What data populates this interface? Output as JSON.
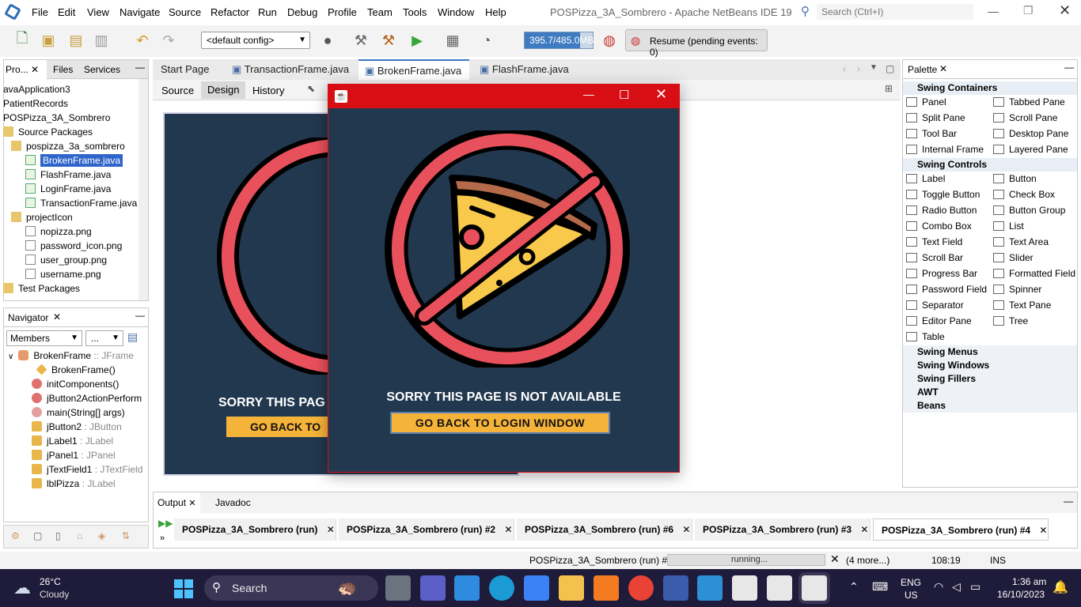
{
  "window": {
    "title": "POSPizza_3A_Sombrero - Apache NetBeans IDE 19"
  },
  "menu": [
    "File",
    "Edit",
    "View",
    "Navigate",
    "Source",
    "Refactor",
    "Run",
    "Debug",
    "Profile",
    "Team",
    "Tools",
    "Window",
    "Help"
  ],
  "search": {
    "placeholder": "Search (Ctrl+I)"
  },
  "toolbar": {
    "config": "<default config>",
    "memory": "395.7/485.0MB",
    "resume": "Resume (pending events: 0)",
    "memory_fraction": 0.816
  },
  "projects": {
    "tabs": [
      "Pro...",
      "Files",
      "Services"
    ],
    "tree": [
      "avaApplication3",
      "PatientRecords",
      "POSPizza_3A_Sombrero",
      "Source Packages",
      "pospizza_3a_sombrero",
      "BrokenFrame.java",
      "FlashFrame.java",
      "LoginFrame.java",
      "TransactionFrame.java",
      "projectIcon",
      "nopizza.png",
      "password_icon.png",
      "user_group.png",
      "username.png",
      "Test Packages"
    ]
  },
  "navigator": {
    "title": "Navigator",
    "filter": "Members",
    "filter2": "...",
    "items": [
      {
        "name": "BrokenFrame",
        "type": " :: JFrame"
      },
      {
        "name": "BrokenFrame()",
        "type": ""
      },
      {
        "name": "initComponents()",
        "type": ""
      },
      {
        "name": "jButton2ActionPerform",
        "type": ""
      },
      {
        "name": "main(String[] args)",
        "type": ""
      },
      {
        "name": "jButton2",
        "type": " : JButton"
      },
      {
        "name": "jLabel1",
        "type": " : JLabel"
      },
      {
        "name": "jPanel1",
        "type": " : JPanel"
      },
      {
        "name": "jTextField1",
        "type": " : JTextField"
      },
      {
        "name": "lblPizza",
        "type": " : JLabel"
      }
    ]
  },
  "editor": {
    "tabs": [
      "Start Page",
      "TransactionFrame.java",
      "BrokenFrame.java",
      "FlashFrame.java"
    ],
    "subtabs": [
      "Source",
      "Design",
      "History"
    ],
    "design_text": "SORRY THIS PAG",
    "design_button": "GO BACK TO"
  },
  "dialog": {
    "message": "SORRY THIS PAGE IS NOT AVAILABLE",
    "button": "GO BACK TO LOGIN WINDOW"
  },
  "palette": {
    "title": "Palette",
    "containers_title": "Swing Containers",
    "containers": [
      "Panel",
      "Tabbed Pane",
      "Split Pane",
      "Scroll Pane",
      "Tool Bar",
      "Desktop Pane",
      "Internal Frame",
      "Layered Pane"
    ],
    "controls_title": "Swing Controls",
    "controls": [
      "Label",
      "Button",
      "Toggle Button",
      "Check Box",
      "Radio Button",
      "Button Group",
      "Combo Box",
      "List",
      "Text Field",
      "Text Area",
      "Scroll Bar",
      "Slider",
      "Progress Bar",
      "Formatted Field",
      "Password Field",
      "Spinner",
      "Separator",
      "Text Pane",
      "Editor Pane",
      "Tree",
      "Table"
    ],
    "collapsed": [
      "Swing Menus",
      "Swing Windows",
      "Swing Fillers",
      "AWT",
      "Beans"
    ]
  },
  "output": {
    "tabs": [
      "Output",
      "Javadoc"
    ],
    "runs": [
      "POSPizza_3A_Sombrero (run)",
      "POSPizza_3A_Sombrero (run) #2",
      "POSPizza_3A_Sombrero (run) #6",
      "POSPizza_3A_Sombrero (run) #3",
      "POSPizza_3A_Sombrero (run) #4"
    ]
  },
  "status": {
    "task": "POSPizza_3A_Sombrero (run) #4",
    "progress": "running...",
    "more": "(4 more...)",
    "position": "108:19",
    "mode": "INS"
  },
  "taskbar": {
    "temp": "26°C",
    "weather": "Cloudy",
    "search": "Search",
    "lang1": "ENG",
    "lang2": "US",
    "time": "1:36 am",
    "date": "16/10/2023"
  },
  "colors": {
    "accent": "#1e3a5f",
    "dialog_bg": "#22384f",
    "button": "#f6b33a",
    "titlebar": "#d70f15"
  }
}
